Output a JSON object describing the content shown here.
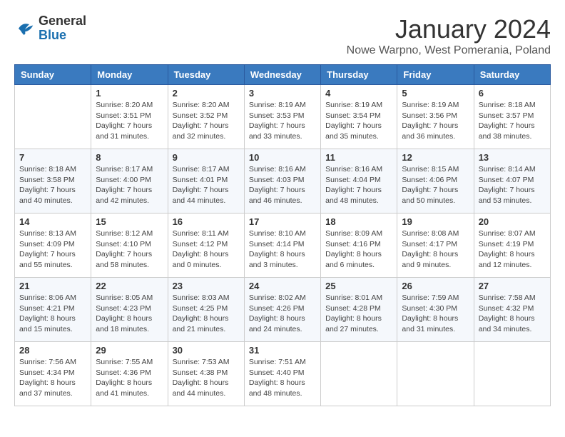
{
  "header": {
    "logo_general": "General",
    "logo_blue": "Blue",
    "month_title": "January 2024",
    "location": "Nowe Warpno, West Pomerania, Poland"
  },
  "weekdays": [
    "Sunday",
    "Monday",
    "Tuesday",
    "Wednesday",
    "Thursday",
    "Friday",
    "Saturday"
  ],
  "weeks": [
    [
      {
        "day": "",
        "info": ""
      },
      {
        "day": "1",
        "info": "Sunrise: 8:20 AM\nSunset: 3:51 PM\nDaylight: 7 hours\nand 31 minutes."
      },
      {
        "day": "2",
        "info": "Sunrise: 8:20 AM\nSunset: 3:52 PM\nDaylight: 7 hours\nand 32 minutes."
      },
      {
        "day": "3",
        "info": "Sunrise: 8:19 AM\nSunset: 3:53 PM\nDaylight: 7 hours\nand 33 minutes."
      },
      {
        "day": "4",
        "info": "Sunrise: 8:19 AM\nSunset: 3:54 PM\nDaylight: 7 hours\nand 35 minutes."
      },
      {
        "day": "5",
        "info": "Sunrise: 8:19 AM\nSunset: 3:56 PM\nDaylight: 7 hours\nand 36 minutes."
      },
      {
        "day": "6",
        "info": "Sunrise: 8:18 AM\nSunset: 3:57 PM\nDaylight: 7 hours\nand 38 minutes."
      }
    ],
    [
      {
        "day": "7",
        "info": "Sunrise: 8:18 AM\nSunset: 3:58 PM\nDaylight: 7 hours\nand 40 minutes."
      },
      {
        "day": "8",
        "info": "Sunrise: 8:17 AM\nSunset: 4:00 PM\nDaylight: 7 hours\nand 42 minutes."
      },
      {
        "day": "9",
        "info": "Sunrise: 8:17 AM\nSunset: 4:01 PM\nDaylight: 7 hours\nand 44 minutes."
      },
      {
        "day": "10",
        "info": "Sunrise: 8:16 AM\nSunset: 4:03 PM\nDaylight: 7 hours\nand 46 minutes."
      },
      {
        "day": "11",
        "info": "Sunrise: 8:16 AM\nSunset: 4:04 PM\nDaylight: 7 hours\nand 48 minutes."
      },
      {
        "day": "12",
        "info": "Sunrise: 8:15 AM\nSunset: 4:06 PM\nDaylight: 7 hours\nand 50 minutes."
      },
      {
        "day": "13",
        "info": "Sunrise: 8:14 AM\nSunset: 4:07 PM\nDaylight: 7 hours\nand 53 minutes."
      }
    ],
    [
      {
        "day": "14",
        "info": "Sunrise: 8:13 AM\nSunset: 4:09 PM\nDaylight: 7 hours\nand 55 minutes."
      },
      {
        "day": "15",
        "info": "Sunrise: 8:12 AM\nSunset: 4:10 PM\nDaylight: 7 hours\nand 58 minutes."
      },
      {
        "day": "16",
        "info": "Sunrise: 8:11 AM\nSunset: 4:12 PM\nDaylight: 8 hours\nand 0 minutes."
      },
      {
        "day": "17",
        "info": "Sunrise: 8:10 AM\nSunset: 4:14 PM\nDaylight: 8 hours\nand 3 minutes."
      },
      {
        "day": "18",
        "info": "Sunrise: 8:09 AM\nSunset: 4:16 PM\nDaylight: 8 hours\nand 6 minutes."
      },
      {
        "day": "19",
        "info": "Sunrise: 8:08 AM\nSunset: 4:17 PM\nDaylight: 8 hours\nand 9 minutes."
      },
      {
        "day": "20",
        "info": "Sunrise: 8:07 AM\nSunset: 4:19 PM\nDaylight: 8 hours\nand 12 minutes."
      }
    ],
    [
      {
        "day": "21",
        "info": "Sunrise: 8:06 AM\nSunset: 4:21 PM\nDaylight: 8 hours\nand 15 minutes."
      },
      {
        "day": "22",
        "info": "Sunrise: 8:05 AM\nSunset: 4:23 PM\nDaylight: 8 hours\nand 18 minutes."
      },
      {
        "day": "23",
        "info": "Sunrise: 8:03 AM\nSunset: 4:25 PM\nDaylight: 8 hours\nand 21 minutes."
      },
      {
        "day": "24",
        "info": "Sunrise: 8:02 AM\nSunset: 4:26 PM\nDaylight: 8 hours\nand 24 minutes."
      },
      {
        "day": "25",
        "info": "Sunrise: 8:01 AM\nSunset: 4:28 PM\nDaylight: 8 hours\nand 27 minutes."
      },
      {
        "day": "26",
        "info": "Sunrise: 7:59 AM\nSunset: 4:30 PM\nDaylight: 8 hours\nand 31 minutes."
      },
      {
        "day": "27",
        "info": "Sunrise: 7:58 AM\nSunset: 4:32 PM\nDaylight: 8 hours\nand 34 minutes."
      }
    ],
    [
      {
        "day": "28",
        "info": "Sunrise: 7:56 AM\nSunset: 4:34 PM\nDaylight: 8 hours\nand 37 minutes."
      },
      {
        "day": "29",
        "info": "Sunrise: 7:55 AM\nSunset: 4:36 PM\nDaylight: 8 hours\nand 41 minutes."
      },
      {
        "day": "30",
        "info": "Sunrise: 7:53 AM\nSunset: 4:38 PM\nDaylight: 8 hours\nand 44 minutes."
      },
      {
        "day": "31",
        "info": "Sunrise: 7:51 AM\nSunset: 4:40 PM\nDaylight: 8 hours\nand 48 minutes."
      },
      {
        "day": "",
        "info": ""
      },
      {
        "day": "",
        "info": ""
      },
      {
        "day": "",
        "info": ""
      }
    ]
  ]
}
